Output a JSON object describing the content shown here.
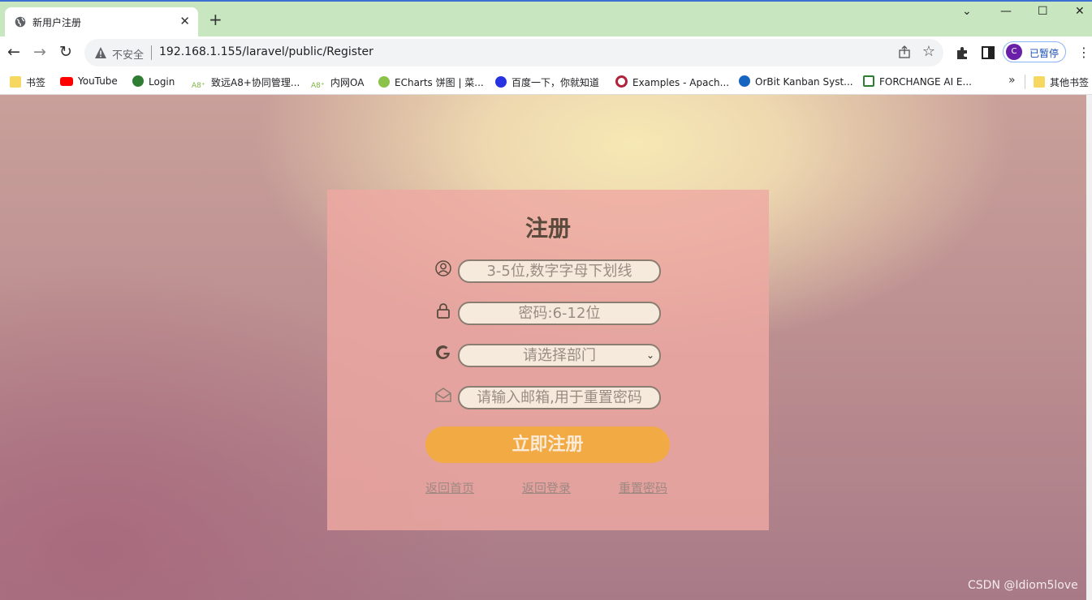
{
  "browser": {
    "tab_title": "新用户注册",
    "new_tab_label": "+",
    "insecure_label": "不安全",
    "url": "192.168.1.155/laravel/public/Register",
    "profile_initial": "C",
    "profile_status": "已暂停",
    "window_controls": {
      "min": "—",
      "max": "☐",
      "close": "✕",
      "tabsearch": "⌄"
    }
  },
  "bookmarks": {
    "items": [
      {
        "label": "书签",
        "icon": "folder-icon",
        "color": "#f6d860"
      },
      {
        "label": "YouTube",
        "icon": "youtube-icon",
        "color": "#ff0000"
      },
      {
        "label": "Login",
        "icon": "globe-icon",
        "color": "#2e7d32"
      },
      {
        "label": "致远A8+协同管理...",
        "icon": "a8-icon",
        "color": "#7cb342"
      },
      {
        "label": "内网OA",
        "icon": "a8-icon",
        "color": "#7cb342"
      },
      {
        "label": "ECharts 饼图 | 菜...",
        "icon": "echarts-icon",
        "color": "#8bc34a"
      },
      {
        "label": "百度一下，你就知道",
        "icon": "baidu-icon",
        "color": "#2932e1"
      },
      {
        "label": "Examples - Apach...",
        "icon": "apache-icon",
        "color": "#b0223a"
      },
      {
        "label": "OrBit Kanban Syst...",
        "icon": "orbit-icon",
        "color": "#1565c0"
      },
      {
        "label": "FORCHANGE AI E...",
        "icon": "forchange-icon",
        "color": "#2e7d32"
      }
    ],
    "more_label": "»",
    "other_label": "其他书签"
  },
  "form": {
    "title": "注册",
    "username_placeholder": "3-5位,数字字母下划线",
    "password_placeholder": "密码:6-12位",
    "department_placeholder": "请选择部门",
    "email_placeholder": "请输入邮箱,用于重置密码",
    "submit_label": "立即注册",
    "links": {
      "home": "返回首页",
      "login": "返回登录",
      "reset": "重置密码"
    }
  },
  "watermark": "CSDN @Idiom5love"
}
